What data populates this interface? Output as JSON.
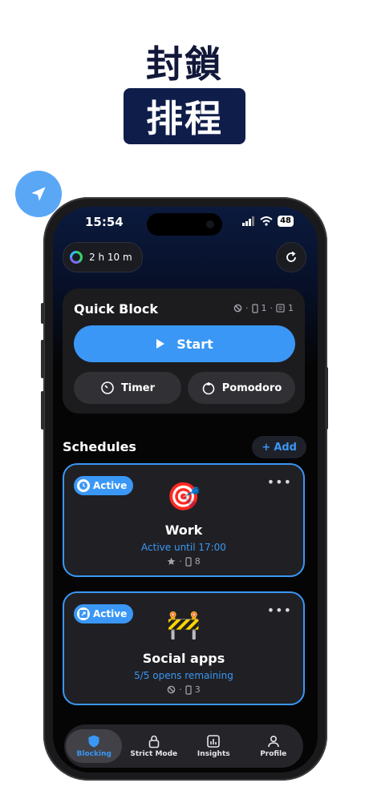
{
  "headline": {
    "line1": "封鎖",
    "line2": "排程"
  },
  "status_bar": {
    "time": "15:54",
    "battery": "48"
  },
  "focus_chip": {
    "duration": "2 h 10 m"
  },
  "quick_block": {
    "title": "Quick Block",
    "meta_count_a": "1",
    "meta_count_b": "1",
    "start_label": "Start",
    "timer_label": "Timer",
    "pomodoro_label": "Pomodoro"
  },
  "schedules": {
    "heading": "Schedules",
    "add_label": "Add",
    "items": [
      {
        "status": "Active",
        "emoji": "🎯",
        "name": "Work",
        "subtitle": "Active until 17:00",
        "count": "8"
      },
      {
        "status": "Active",
        "emoji": "🚧",
        "name": "Social apps",
        "subtitle": "5/5 opens remaining",
        "count": "3"
      }
    ]
  },
  "tabs": [
    {
      "label": "Blocking"
    },
    {
      "label": "Strict Mode"
    },
    {
      "label": "Insights"
    },
    {
      "label": "Profile"
    }
  ],
  "colors": {
    "accent": "#3a97f5",
    "headline": "#12183a",
    "headline_box": "#0f1d4a"
  }
}
